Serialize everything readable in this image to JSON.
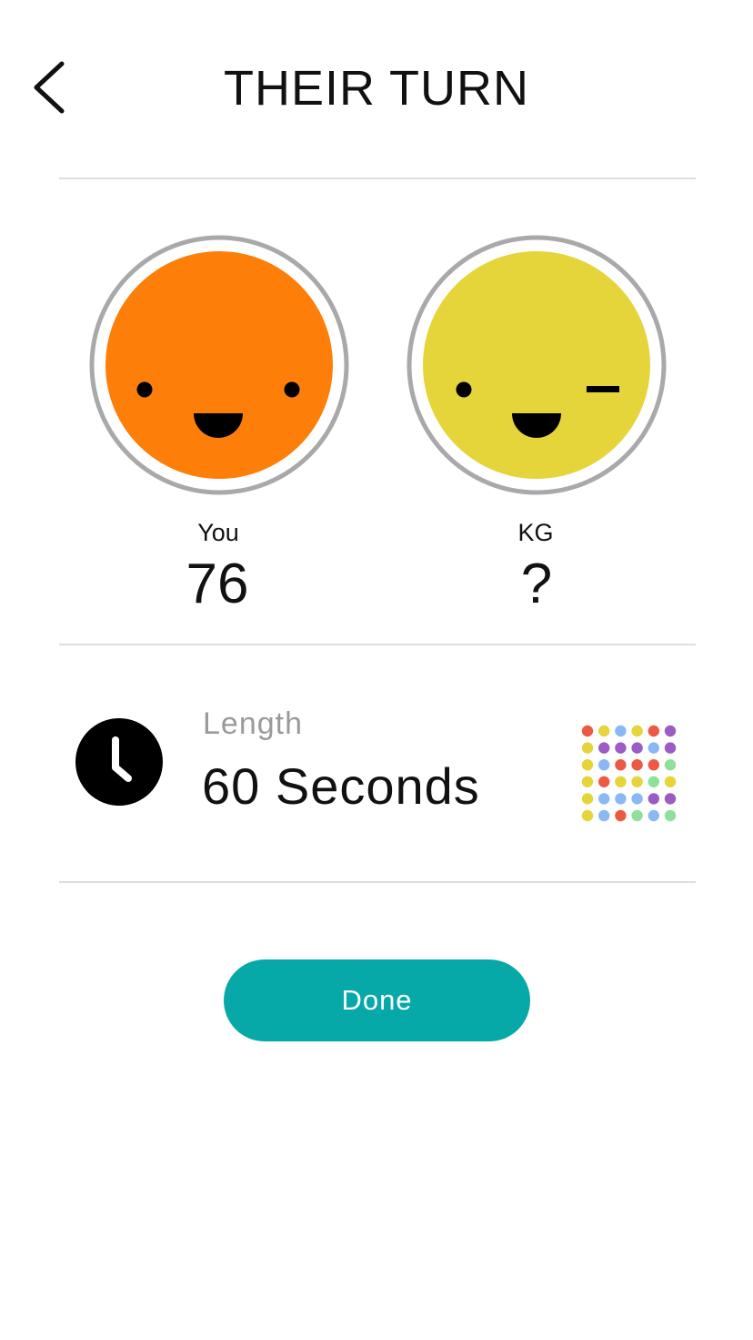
{
  "header": {
    "title": "THEIR TURN",
    "back_icon": "chevron-left-icon"
  },
  "players": [
    {
      "name": "You",
      "score": "76",
      "face_color": "#fd7e08",
      "expression": "smile"
    },
    {
      "name": "KG",
      "score": "?",
      "face_color": "#e5d43a",
      "expression": "wink"
    }
  ],
  "game": {
    "length_label": "Length",
    "length_value": "60 Seconds",
    "clock_icon": "clock-icon",
    "board_icon": "dots-grid-icon"
  },
  "actions": {
    "done_label": "Done"
  },
  "colors": {
    "accent": "#07a9a8",
    "divider": "#dedede",
    "ring": "#a9a9a9",
    "dot_red": "#ec5a44",
    "dot_yellow": "#e5d43a",
    "dot_blue": "#8ab8f5",
    "dot_purple": "#9b5cc6",
    "dot_green": "#8fe09a"
  },
  "dot_grid": [
    [
      "red",
      "yellow",
      "blue",
      "yellow",
      "red",
      "purple"
    ],
    [
      "yellow",
      "purple",
      "purple",
      "purple",
      "blue",
      "purple"
    ],
    [
      "yellow",
      "blue",
      "red",
      "red",
      "red",
      "green"
    ],
    [
      "yellow",
      "red",
      "yellow",
      "yellow",
      "green",
      "yellow"
    ],
    [
      "yellow",
      "blue",
      "blue",
      "blue",
      "purple",
      "purple"
    ],
    [
      "yellow",
      "blue",
      "red",
      "green",
      "blue",
      "green"
    ]
  ]
}
